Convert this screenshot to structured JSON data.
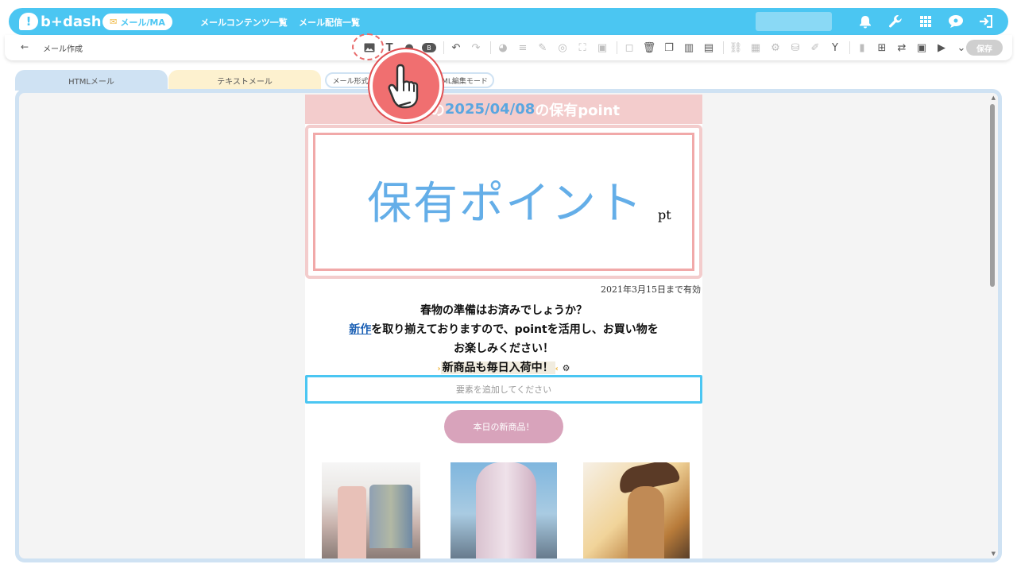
{
  "app": {
    "logo_text": "b+dash",
    "logo_mark": "!",
    "module_pill": "メール/MA",
    "nav": [
      "メールコンテンツ一覧",
      "メール配信一覧"
    ]
  },
  "subbar": {
    "back_icon": "←",
    "breadcrumb": "メール作成",
    "save_label": "保存"
  },
  "tabs": {
    "html_tab": "HTMLメール",
    "text_tab": "テキストメール",
    "mode_left": "メール形式",
    "mode_right": "ML編集モード"
  },
  "mail": {
    "header_prefix": "様さんの",
    "header_date": "2025/04/08",
    "header_suffix": "の保有point",
    "card_title": "保有ポイント",
    "card_unit": "pt",
    "valid_until": "2021年3月15日まで有効",
    "line1": "春物の準備はお済みでしょうか？",
    "line2_link": "新作",
    "line2_rest": "を取り揃えておりますので、pointを活用し、お買い物を",
    "line3": "お楽しみください！",
    "line4": "新商品も毎日入荷中！",
    "add_element_placeholder": "要素を追加してください",
    "button_label": "本日の新商品！"
  },
  "colors": {
    "topbar": "#4bc6f2",
    "accent_pink": "#f3cccc",
    "title_blue": "#64aee8",
    "button_pink": "#d8a3bb",
    "pointer_red": "#f06f70"
  },
  "icons": {
    "toolbar": [
      "image-icon",
      "text-icon",
      "person-icon",
      "badge-icon",
      "undo-icon",
      "redo-icon",
      "palette-icon",
      "align-icon",
      "pen-icon",
      "target-icon",
      "expand-icon",
      "image-frame-icon",
      "copy-icon",
      "trash-icon",
      "duplicate-icon",
      "columns-icon",
      "rows-icon",
      "link-icon",
      "calendar-icon",
      "gears-icon",
      "database-icon",
      "note-icon",
      "fork-icon",
      "chart-icon",
      "grid-add-icon",
      "link-swap-icon",
      "person-card-icon",
      "play-icon",
      "chevron-down-icon"
    ],
    "top_right": [
      "bell-icon",
      "wrench-icon",
      "apps-grid-icon",
      "chat-bubble-icon",
      "logout-icon"
    ]
  }
}
